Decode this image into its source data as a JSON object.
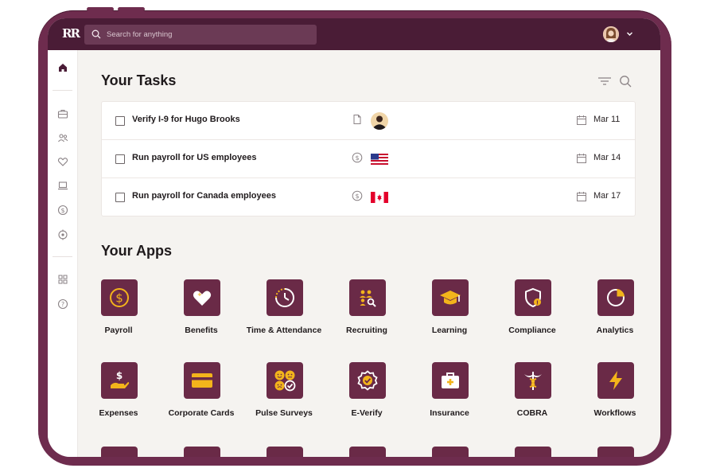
{
  "colors": {
    "device": "#6e2c4e",
    "topbar": "#4a1c36",
    "tile": "#6a2a47",
    "accent": "#f3b41b"
  },
  "topbar": {
    "logo": "RR",
    "search_placeholder": "Search for anything",
    "profile_icon": "avatar-icon",
    "menu_icon": "chevron-down-icon"
  },
  "sidebar": {
    "items": [
      {
        "icon": "home-icon"
      },
      {
        "icon": "briefcase-icon"
      },
      {
        "icon": "people-icon"
      },
      {
        "icon": "heart-icon"
      },
      {
        "icon": "laptop-icon"
      },
      {
        "icon": "dollar-icon"
      },
      {
        "icon": "target-icon"
      },
      {
        "icon": "apps-icon"
      },
      {
        "icon": "help-icon"
      }
    ]
  },
  "tasks": {
    "title": "Your Tasks",
    "items": [
      {
        "label": "Verify I-9 for Hugo Brooks",
        "date": "Mar 11",
        "type_icon": "document-icon",
        "thumb": "person-avatar"
      },
      {
        "label": "Run payroll for US employees",
        "date": "Mar 14",
        "type_icon": "dollar-icon",
        "thumb": "us-flag"
      },
      {
        "label": "Run payroll for Canada employees",
        "date": "Mar 17",
        "type_icon": "dollar-icon",
        "thumb": "canada-flag"
      }
    ]
  },
  "apps": {
    "title": "Your Apps",
    "items": [
      {
        "label": "Payroll",
        "icon": "dollar-icon"
      },
      {
        "label": "Benefits",
        "icon": "heart-icon"
      },
      {
        "label": "Time & Attendance",
        "icon": "clock-icon"
      },
      {
        "label": "Recruiting",
        "icon": "recruiting-icon"
      },
      {
        "label": "Learning",
        "icon": "graduation-cap-icon"
      },
      {
        "label": "Compliance",
        "icon": "shield-icon"
      },
      {
        "label": "Analytics",
        "icon": "pie-chart-icon"
      },
      {
        "label": "Expenses",
        "icon": "hand-dollar-icon"
      },
      {
        "label": "Corporate Cards",
        "icon": "card-icon"
      },
      {
        "label": "Pulse Surveys",
        "icon": "smiley-icon"
      },
      {
        "label": "E-Verify",
        "icon": "badge-check-icon"
      },
      {
        "label": "Insurance",
        "icon": "medical-bag-icon"
      },
      {
        "label": "COBRA",
        "icon": "caduceus-icon"
      },
      {
        "label": "Workflows",
        "icon": "lightning-icon"
      }
    ]
  }
}
